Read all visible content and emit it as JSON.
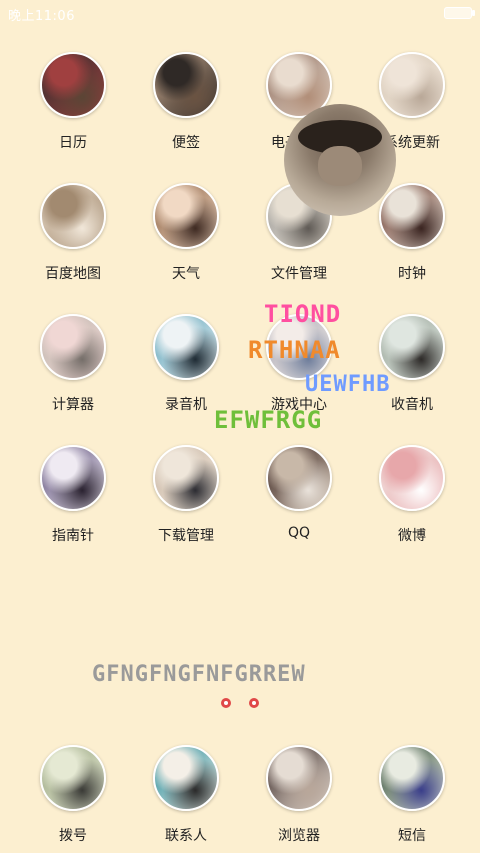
{
  "status_bar": {
    "time": "晚上11:06"
  },
  "apps": [
    {
      "label": "日历",
      "colors": [
        "#2b2b2b",
        "#a04040",
        "#5b4535"
      ]
    },
    {
      "label": "便签",
      "colors": [
        "#c3a48a",
        "#2f2926",
        "#6a5342"
      ]
    },
    {
      "label": "电子邮件",
      "colors": [
        "#8c6a5a",
        "#e9dccf",
        "#b18e78"
      ]
    },
    {
      "label": "系统更新",
      "colors": [
        "#d8cab8",
        "#efe4d8",
        "#b9a898"
      ]
    },
    {
      "label": "百度地图",
      "colors": [
        "#e6d8c6",
        "#a28a70",
        "#f1e7d9"
      ]
    },
    {
      "label": "天气",
      "colors": [
        "#8a6042",
        "#f1d9c4",
        "#3e2a22"
      ]
    },
    {
      "label": "文件管理",
      "colors": [
        "#9b9a98",
        "#e7dfd2",
        "#5f5a55"
      ]
    },
    {
      "label": "时钟",
      "colors": [
        "#6a3a2e",
        "#e9e2d8",
        "#3a2420"
      ]
    },
    {
      "label": "计算器",
      "colors": [
        "#bfb7ae",
        "#f0d7d4",
        "#756e69"
      ]
    },
    {
      "label": "录音机",
      "colors": [
        "#5aa2b8",
        "#eef3f5",
        "#1f2b34"
      ]
    },
    {
      "label": "游戏中心",
      "colors": [
        "#a7a7b3",
        "#f3ece8",
        "#6f7e9c"
      ]
    },
    {
      "label": "收音机",
      "colors": [
        "#9aa69a",
        "#dfe6e0",
        "#2d2a28"
      ]
    },
    {
      "label": "指南针",
      "colors": [
        "#5d4f7a",
        "#efeaf2",
        "#2a2230"
      ]
    },
    {
      "label": "下载管理",
      "colors": [
        "#c9b6a4",
        "#efe6da",
        "#2c2c32"
      ]
    },
    {
      "label": "QQ",
      "colors": [
        "#3e2a26",
        "#c8b8a8",
        "#e9e2da"
      ]
    },
    {
      "label": "微博",
      "colors": [
        "#f3e7e4",
        "#e7a7aa",
        "#ffffff"
      ]
    }
  ],
  "dock": [
    {
      "label": "拨号",
      "colors": [
        "#9aa682",
        "#e5e9d3",
        "#3a3a36"
      ]
    },
    {
      "label": "联系人",
      "colors": [
        "#1f8a9a",
        "#f4efe7",
        "#2b2a2a"
      ]
    },
    {
      "label": "浏览器",
      "colors": [
        "#3a2926",
        "#e5dcd3",
        "#b9a79a"
      ]
    },
    {
      "label": "短信",
      "colors": [
        "#2f4a35",
        "#e8ebe1",
        "#3a3e8a"
      ]
    }
  ],
  "decor": {
    "t1": "TIOND",
    "t2": "RTHNAA",
    "t3": "UEWFHB",
    "t4": "EFWFRGG",
    "t5": "GFNGFNGFNFGRREW"
  },
  "accent": {
    "pink": "#ff4fa0",
    "orange": "#f08a2c",
    "blue": "#6f9bff",
    "green": "#6fbf3a",
    "grey": "#9a9a9a"
  }
}
